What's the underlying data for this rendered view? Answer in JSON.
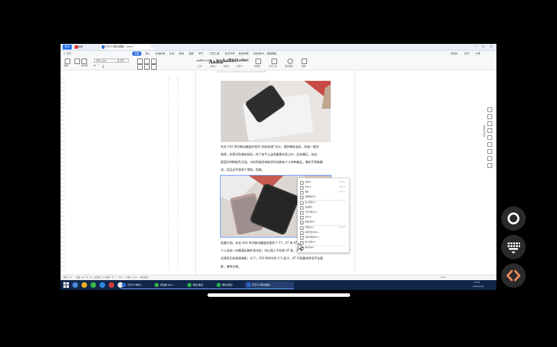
{
  "tabs": {
    "home": "首页",
    "wps": "稻壳",
    "doc": "东芝V10移动硬盘....docx",
    "plus": "+"
  },
  "window_controls": "— ▢ ✕",
  "menus": [
    "三 文件",
    "开始",
    "插入",
    "页面布局",
    "引用",
    "审阅",
    "视图",
    "章节",
    "开发工具",
    "会员专享",
    "稻壳资源",
    "Q查找命令、搜索模板"
  ],
  "active_menu": "开始",
  "right_menu": [
    "未同步",
    "协作",
    "分享"
  ],
  "toolbar": {
    "paste": "粘贴",
    "format_painter": "格式刷",
    "font_name": "宋体 (正文)",
    "font_size": "五号",
    "styles": [
      "AaBbCcDd",
      "AaBb",
      "AaBbC",
      "AaBbC"
    ],
    "style_labels": [
      "正文",
      "标题 1",
      "标题 2",
      "标题 3"
    ],
    "new_style": "新样式",
    "text_tools": "文字工具",
    "find_replace": "查找替换",
    "select": "选择"
  },
  "doc": {
    "para1": [
      "东芝 V10 系列移动硬盘外观为“织纹纹理”设计，提供精致出彩，再者一直别",
      "致感，防滑又防指纹轻松。除了有手上出现重要东西之外，还有曜石、米白、",
      "蔚蓝共四种配色可选，对向积极性每批印时刻具有个人的审美品，事些手更能静",
      "读，而且还不容易下滑划，刮痕。"
    ],
    "para2": [
      "容量方面，东芝 V10 系列移动硬盘也提供了 1T、2T 和 4T 多种容量，方便",
      "个人选选一向需满足稿件里浏览，所以我入手的是 4T 款，用来进行备份，体验",
      "无损音乐和高清电影。对了，V10 系列均为 2.5 英寸，4T 大容量体积也不会展",
      "胖，携带方便。"
    ],
    "ruler_marks": "2 4 6 8 10 12 14 16 18 20 22 24 26 28 30 32 34 36 38"
  },
  "context_menu": [
    {
      "label": "复制(C)",
      "key": "Ctrl+C"
    },
    {
      "label": "剪切(T)",
      "key": "Ctrl+X"
    },
    {
      "label": "粘贴",
      "key": "Ctrl+V"
    },
    {
      "label": "提取图中文字",
      "key": ""
    },
    {
      "label": "插入题注(N)...",
      "key": ""
    },
    {
      "label": "更改图片...",
      "key": ""
    },
    {
      "label": "另存为图片(S)...",
      "key": ""
    },
    {
      "label": "组合(G)",
      "key": ""
    },
    {
      "label": "叠放次序(R)",
      "key": ""
    },
    {
      "label": "超链接(H)...",
      "key": "Ctrl+K"
    },
    {
      "label": "其他布局选项(L)...",
      "key": ""
    },
    {
      "label": "设置对象格式(O)...",
      "key": ""
    },
    {
      "label": "插入批注(M)",
      "key": ""
    },
    {
      "label": "图片转PDF",
      "key": ""
    }
  ],
  "statusbar": {
    "page": "页码: 3/7",
    "pages": "页面: 3/7",
    "section": "节: 1/1",
    "line": "设置值: 23.9厘米",
    "row": "行: 7",
    "col": "列: 1",
    "words": "字数: 2139",
    "spell": "拼写检查",
    "zoom": "100%"
  },
  "taskbar": {
    "items": [
      "东芝V10移动...",
      "浏览器-Goo...",
      "微信(微信)",
      "微信(微信)",
      "东芝V10移动硬盘..."
    ],
    "time": "23:01",
    "date": "2021/7/15"
  },
  "colors": {
    "accent": "#2f6fd6",
    "taskbar": "#11264a",
    "orange_button": "#f08a5d"
  }
}
